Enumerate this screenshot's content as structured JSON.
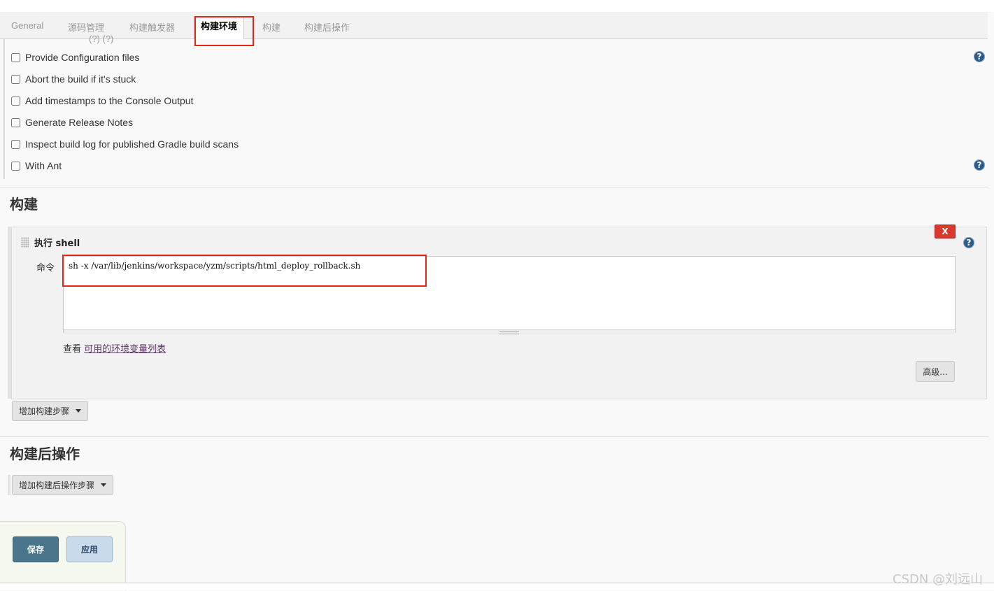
{
  "tabs": [
    {
      "label": "General"
    },
    {
      "label": "源码管理"
    },
    {
      "label": "构建触发器"
    },
    {
      "label": "构建环境",
      "active": true
    },
    {
      "label": "构建"
    },
    {
      "label": "构建后操作"
    }
  ],
  "build_env": {
    "partial_row": "(?)    (?)",
    "options": [
      {
        "label": "Provide Configuration files",
        "checked": false
      },
      {
        "label": "Abort the build if it's stuck",
        "checked": false
      },
      {
        "label": "Add timestamps to the Console Output",
        "checked": false
      },
      {
        "label": "Generate Release Notes",
        "checked": false
      },
      {
        "label": "Inspect build log for published Gradle build scans",
        "checked": false
      },
      {
        "label": "With Ant",
        "checked": false
      }
    ]
  },
  "build": {
    "section_title": "构建",
    "step": {
      "title": "执行 shell",
      "delete_label": "X",
      "command_label": "命令",
      "command_value": "sh -x /var/lib/jenkins/workspace/yzm/scripts/html_deploy_rollback.sh",
      "env_prefix": "查看 ",
      "env_link": "可用的环境变量列表",
      "advanced_label": "高级..."
    },
    "add_step_label": "增加构建步骤"
  },
  "post_build": {
    "section_title": "构建后操作",
    "add_step_label": "增加构建后操作步骤"
  },
  "actions": {
    "save_label": "保存",
    "apply_label": "应用"
  },
  "help_icon_glyph": "?",
  "watermark": "CSDN @刘远山",
  "colors": {
    "save_button": "#4b758b",
    "apply_button": "#c9daeb",
    "delete_button": "#d9382c",
    "help_icon": "#2d5b8a",
    "highlight_box": "#e3261c"
  }
}
